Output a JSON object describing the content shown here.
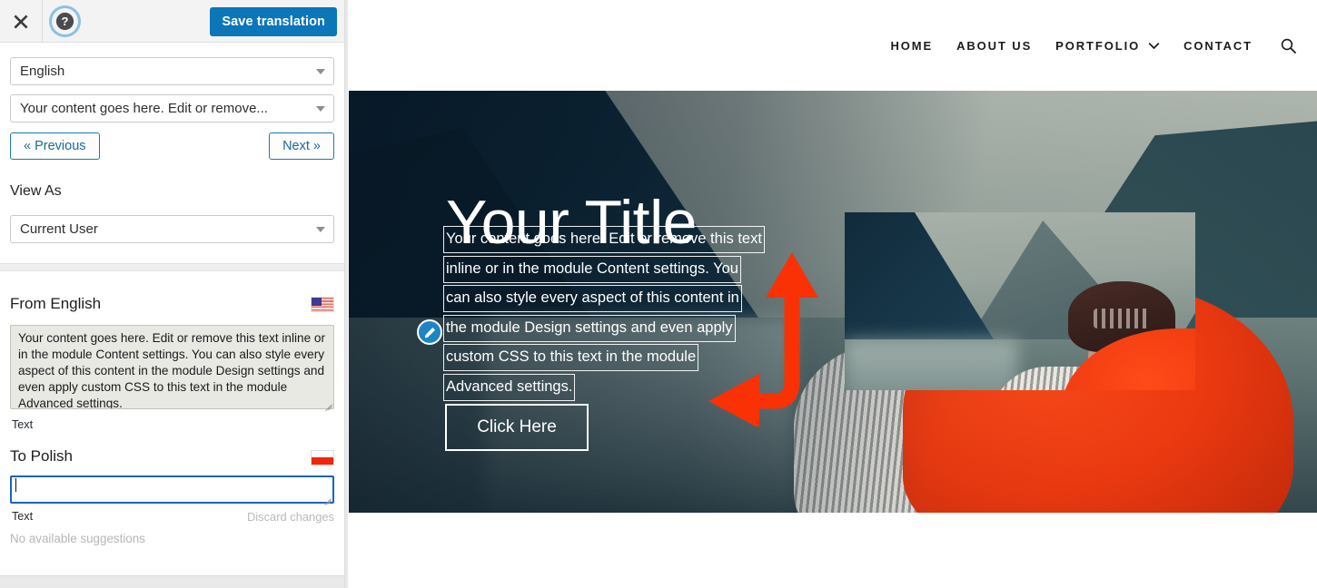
{
  "translation_panel": {
    "toolbar": {
      "close_icon": "close-x-icon",
      "help_icon": "question-mark-icon",
      "save_label": "Save translation",
      "save_bg": "#0b76b8"
    },
    "language_select": {
      "value": "English",
      "caret_icon": "chevron-down-icon"
    },
    "string_select": {
      "value": "Your content goes here. Edit or remove...",
      "caret_icon": "chevron-down-icon"
    },
    "prev_label": "« Previous",
    "next_label": "Next »",
    "view_as": {
      "label": "View As",
      "value": "Current User",
      "caret_icon": "chevron-down-icon"
    },
    "source": {
      "heading": "From English",
      "flag_icon": "flag-us-icon",
      "text": "Your content goes here. Edit or remove this text inline or in the module Content settings. You can also style every aspect of this content in the module Design settings and even apply custom CSS to this text in the module Advanced settings.",
      "meta_label": "Text"
    },
    "target": {
      "heading": "To Polish",
      "flag_icon": "flag-pl-icon",
      "value": "",
      "meta_label": "Text",
      "discard_label": "Discard changes",
      "focus_color": "#1565c0"
    },
    "suggestions_empty": "No available suggestions"
  },
  "site_preview": {
    "nav": {
      "items": [
        {
          "label": "HOME",
          "has_caret": false
        },
        {
          "label": "ABOUT US",
          "has_caret": false
        },
        {
          "label": "PORTFOLIO",
          "has_caret": true
        },
        {
          "label": "CONTACT",
          "has_caret": false
        }
      ],
      "caret_icon": "chevron-down-icon",
      "search_icon": "search-icon"
    },
    "hero": {
      "title": "Your Title",
      "body_lines": [
        "Your content goes here. Edit or remove this text",
        "inline or in the module Content settings. You",
        "can also style every aspect of this content in",
        "the module Design settings and even apply",
        "custom CSS to this text in the module",
        "Advanced settings."
      ],
      "edit_badge_icon": "pencil-edit-icon",
      "cta_label": "Click Here",
      "nested_image_alt": "kayaker-fjord-photo"
    },
    "annotation": {
      "arrow_icon": "curved-double-arrow-annotation",
      "arrow_color": "#fa3105"
    }
  }
}
